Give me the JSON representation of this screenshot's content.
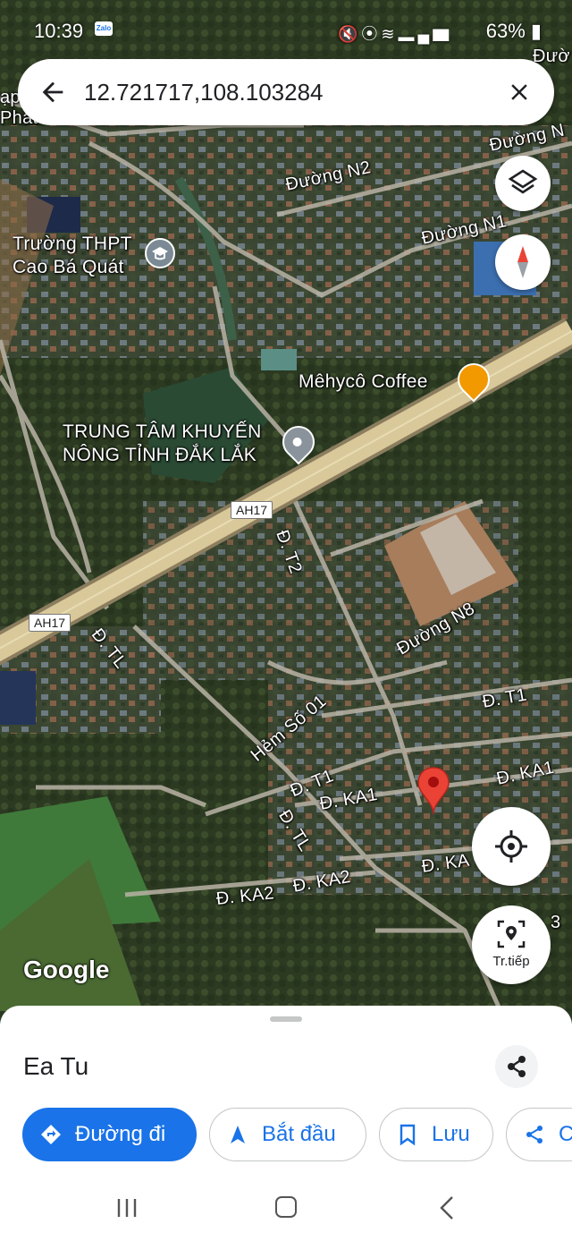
{
  "status_bar": {
    "time": "10:39",
    "app_badge": "Zalo",
    "battery": "63%"
  },
  "search": {
    "query": "12.721717,108.103284",
    "back_icon": "arrow-left-icon",
    "close_icon": "close-icon"
  },
  "map": {
    "labels": {
      "duong_n2": "Đường N2",
      "duong_n1": "Đường N1",
      "duong_n_top": "Đường N",
      "top_right": "Đườ",
      "truong_line1": "Trường THPT",
      "truong_line2": "Cao Bá Quát",
      "top_left_line1": "ạp",
      "top_left_line2": "Phát",
      "mehyco": "Mêhycô Coffee",
      "trungtam_line1": "TRUNG TÂM KHUYẾN",
      "trungtam_line2": "NÔNG TỈNH ĐẮK LẮK",
      "ah17_a": "AH17",
      "ah17_b": "AH17",
      "d_t2": "Đ. T2",
      "d_tl_a": "Đ. TL",
      "d_tl_b": "Đ. TL",
      "duong_n8": "Đường N8",
      "d_t1_a": "Đ. T1",
      "d_t1_b": "Đ. T1",
      "hem": "Hẻm Số 01",
      "d_ka1_a": "Đ. KA1",
      "d_ka1_b": "Đ. KA1",
      "d_ka2_a": "Đ. KA2",
      "d_ka2_b": "Đ. KA2",
      "d_ka_c": "Đ. KA",
      "edge_3": "3"
    },
    "attribution": "Google"
  },
  "buttons": {
    "layers_icon": "layers-icon",
    "compass_icon": "compass-icon",
    "locate_icon": "my-location-icon",
    "navigate_label": "Tr.tiếp"
  },
  "sheet": {
    "place_name": "Ea Tu",
    "chips": {
      "directions": "Đường đi",
      "start": "Bắt đầu",
      "save": "Lưu",
      "share": "C"
    }
  },
  "colors": {
    "accent": "#1a73e8",
    "pin": "#ea4335",
    "poi_orange": "#f29900"
  }
}
